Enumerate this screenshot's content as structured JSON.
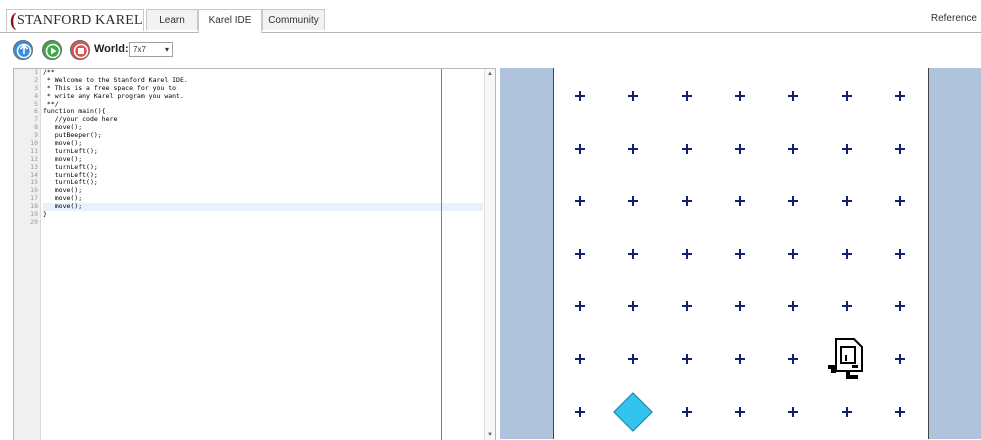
{
  "nav": {
    "logo_mark": "(",
    "logo_text": "STANFORD KAREL",
    "tabs": [
      "Learn",
      "Karel IDE",
      "Community"
    ],
    "active_tab": "Karel IDE",
    "reference": "Reference"
  },
  "toolbar": {
    "world_label": "World:",
    "world_value": "7x7"
  },
  "editor": {
    "line_numbers": [
      "1",
      "2",
      "3",
      "4",
      "5",
      "6",
      "7",
      "8",
      "9",
      "10",
      "11",
      "12",
      "13",
      "14",
      "15",
      "16",
      "17",
      "18",
      "19",
      "20"
    ],
    "lines": [
      "/**",
      " * Welcome to the Stanford Karel IDE.",
      " * This is a free space for you to",
      " * write any Karel program you want.",
      " **/",
      "function main(){",
      "   //your code here",
      "   move();",
      "   putBeeper();",
      "   move();",
      "   turnLeft();",
      "   move();",
      "   turnLeft();",
      "   turnLeft();",
      "   turnLeft();",
      "   move();",
      "   move();",
      "   move();",
      "}",
      ""
    ],
    "current_line": 18
  },
  "world": {
    "size": "7x7",
    "grid_cols": 7,
    "grid_rows": 7,
    "beeper": {
      "col": 2,
      "row": 1
    },
    "karel": {
      "col": 6,
      "row": 2,
      "facing": "north"
    }
  },
  "colors": {
    "world_bg": "#afc3dc",
    "beeper": "#33c3f0",
    "corner": "#14206b"
  }
}
